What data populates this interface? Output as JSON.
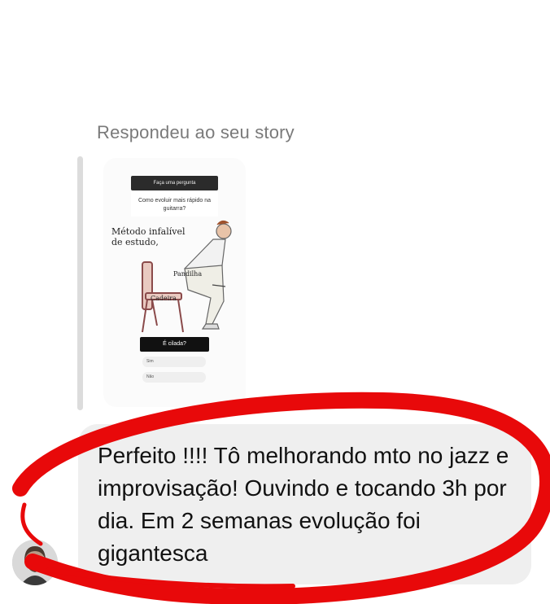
{
  "reply_label": "Respondeu ao seu story",
  "story": {
    "header": "Faça uma pergunta",
    "question": "Como evoluir mais rápido na guitarra?",
    "meme_caption": "Método infalível de estudo,",
    "meme_label_person": "Pandilha",
    "meme_label_chair": "Cadeira",
    "poll_title": "É cilada?",
    "poll_options": [
      "Sim",
      "Não"
    ]
  },
  "message": {
    "text": "Perfeito !!!! Tô melhorando mto no jazz e improvisação! Ouvindo e tocando 3h por dia. Em 2 semanas evolução foi gigantesca"
  },
  "colors": {
    "bubble": "#efefef",
    "highlight_ring": "#e8090a",
    "label": "#7a7a7a"
  },
  "icons": {
    "avatar": "user-avatar-photo"
  }
}
